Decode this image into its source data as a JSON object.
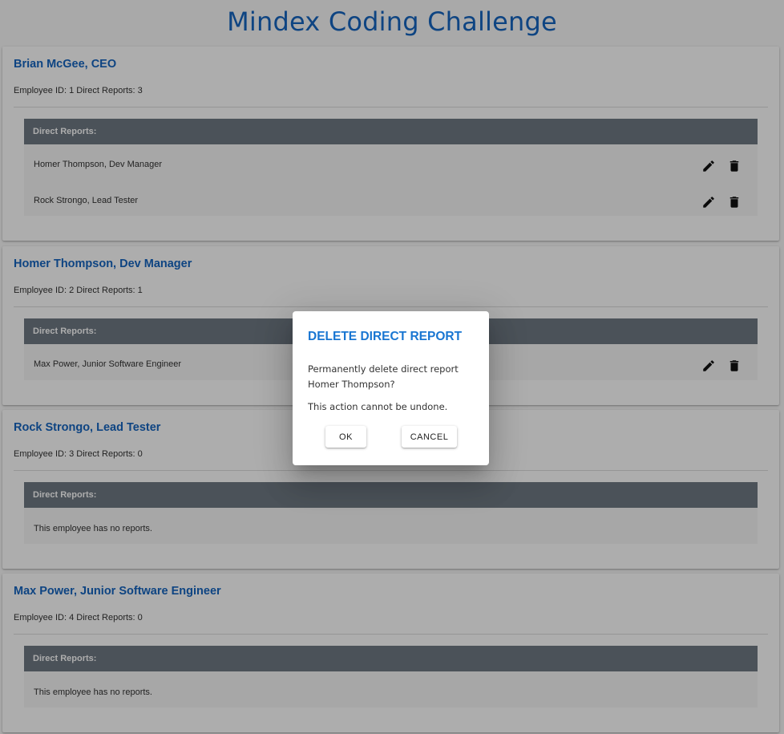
{
  "app": {
    "title": "Mindex Coding Challenge"
  },
  "employees": [
    {
      "name": "Brian McGee, CEO",
      "meta": "Employee ID: 1 Direct Reports: 3",
      "reports_header": "Direct Reports:",
      "reports": [
        "Homer Thompson, Dev Manager",
        "Rock Strongo, Lead Tester"
      ]
    },
    {
      "name": "Homer Thompson, Dev Manager",
      "meta": "Employee ID: 2 Direct Reports: 1",
      "reports_header": "Direct Reports:",
      "reports": [
        "Max Power, Junior Software Engineer"
      ]
    },
    {
      "name": "Rock Strongo, Lead Tester",
      "meta": "Employee ID: 3 Direct Reports: 0",
      "reports_header": "Direct Reports:",
      "empty": "This employee has no reports."
    },
    {
      "name": "Max Power, Junior Software Engineer",
      "meta": "Employee ID: 4 Direct Reports: 0",
      "reports_header": "Direct Reports:",
      "empty": "This employee has no reports."
    }
  ],
  "icons": {
    "edit": "pencil-icon",
    "delete": "trash-icon"
  },
  "dialog": {
    "title": "DELETE DIRECT REPORT",
    "message": "Permanently delete direct report Homer Thompson?",
    "warning": "This action cannot be undone.",
    "ok_label": "OK",
    "cancel_label": "CANCEL"
  },
  "colors": {
    "accent": "#1565c0",
    "header_bar": "#6f7983",
    "overlay": "rgba(0,0,0,0.32)"
  }
}
